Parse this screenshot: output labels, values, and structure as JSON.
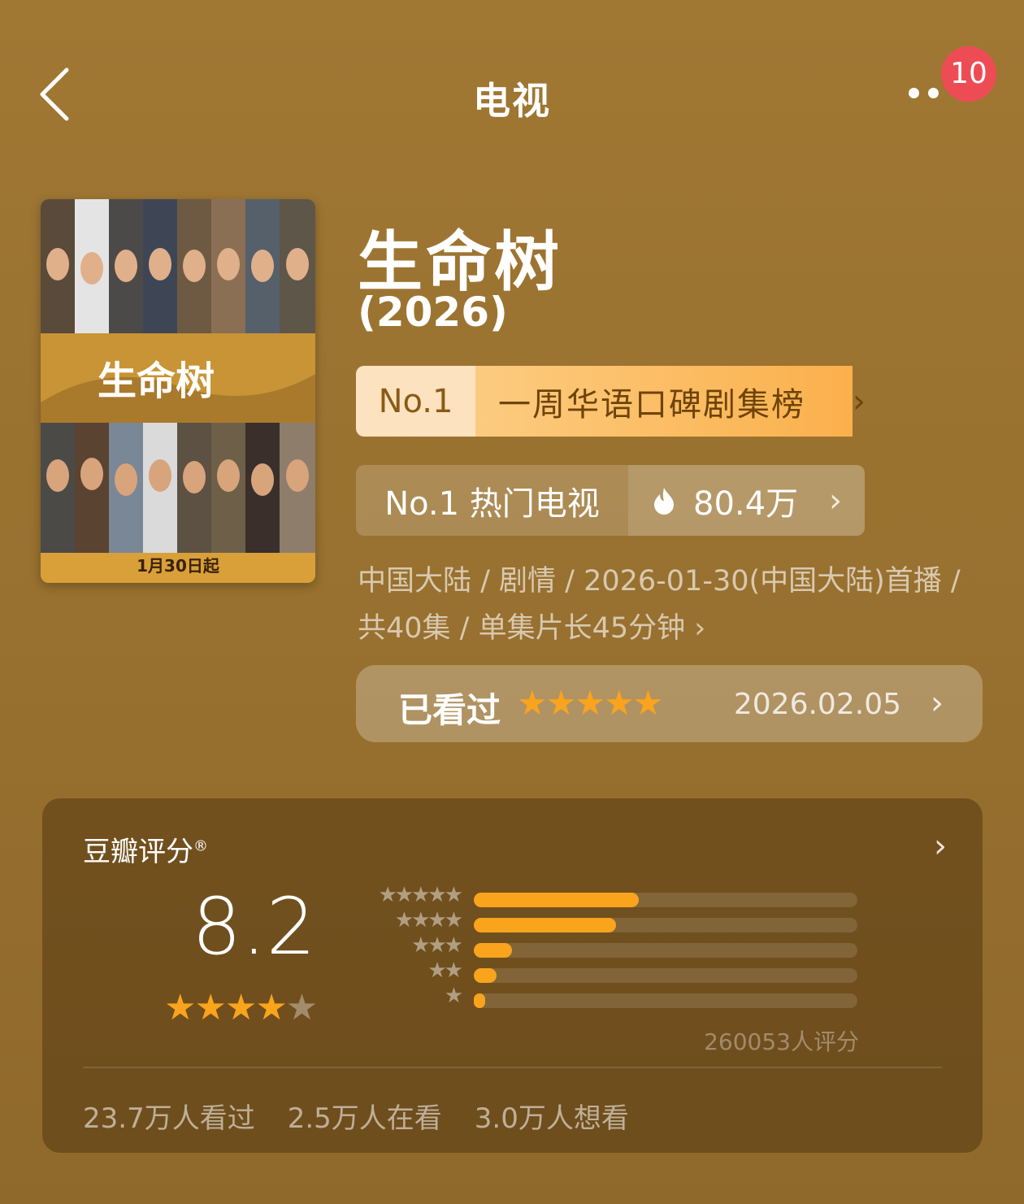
{
  "nav": {
    "title": "电视",
    "badge": "10"
  },
  "poster": {
    "title_art": "生命树",
    "date_caption": "1月30日起"
  },
  "show": {
    "title": "生命树",
    "year": "(2026)"
  },
  "rank_primary": {
    "no": "No.1",
    "label": "一周华语口碑剧集榜"
  },
  "rank_secondary": {
    "label": "No.1 热门电视",
    "heat": "80.4万"
  },
  "meta": {
    "line1": "中国大陆 / 剧情 / 2026-01-30(中国大陆)首播 /",
    "line2": "共40集 / 单集片长45分钟"
  },
  "watched": {
    "label": "已看过",
    "my_stars": 5,
    "date": "2026.02.05"
  },
  "rating": {
    "title": "豆瓣评分",
    "score": "8.2",
    "stars": 4,
    "distribution": [
      {
        "stars": 5,
        "fraction": 0.43
      },
      {
        "stars": 4,
        "fraction": 0.37
      },
      {
        "stars": 3,
        "fraction": 0.1
      },
      {
        "stars": 2,
        "fraction": 0.06
      },
      {
        "stars": 1,
        "fraction": 0.03
      }
    ],
    "count": "260053人评分"
  },
  "stats": {
    "watched": "23.7万人看过",
    "watching": "2.5万人在看",
    "want": "3.0万人想看"
  },
  "colors": {
    "accent": "#f9a41c",
    "badge": "#ee4c55",
    "background": "#9c7431"
  }
}
